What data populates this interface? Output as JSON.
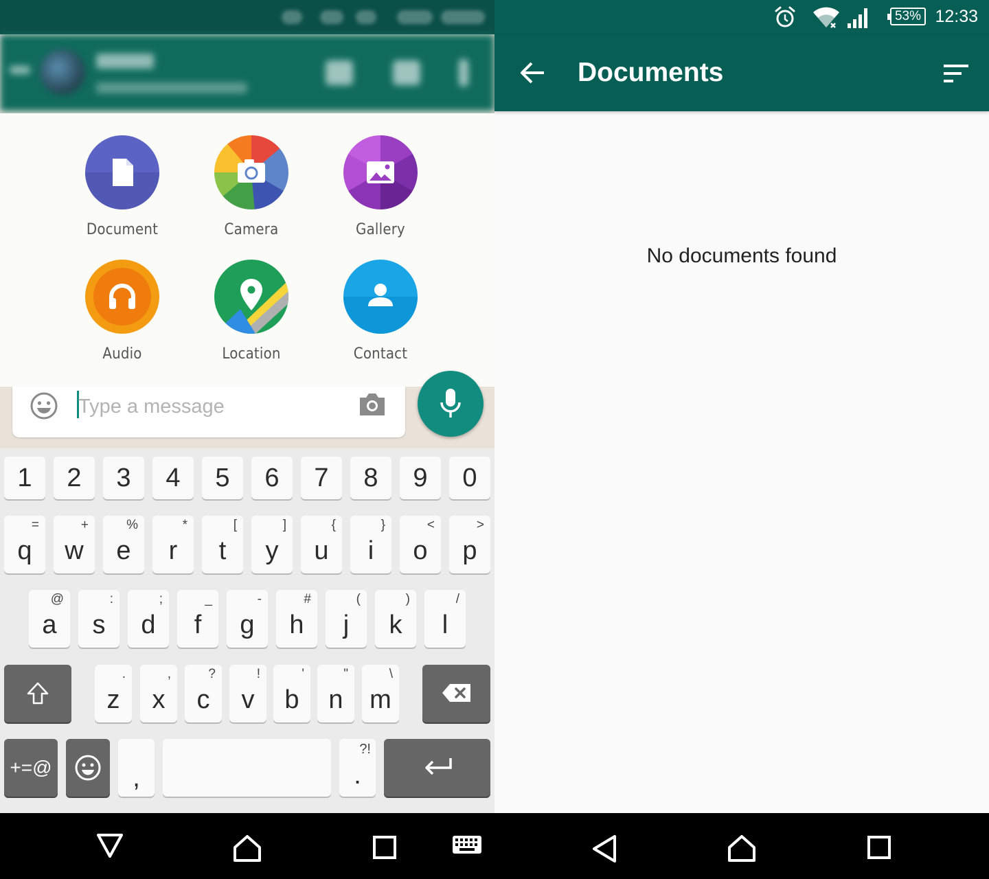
{
  "left": {
    "attach_items": [
      {
        "label": "Document",
        "icon": "document-icon"
      },
      {
        "label": "Camera",
        "icon": "camera-icon"
      },
      {
        "label": "Gallery",
        "icon": "gallery-icon"
      },
      {
        "label": "Audio",
        "icon": "headphones-icon"
      },
      {
        "label": "Location",
        "icon": "location-pin-icon"
      },
      {
        "label": "Contact",
        "icon": "person-icon"
      }
    ],
    "message_placeholder": "Type a message",
    "keyboard": {
      "numbers": [
        "1",
        "2",
        "3",
        "4",
        "5",
        "6",
        "7",
        "8",
        "9",
        "0"
      ],
      "row1": [
        [
          "q",
          "="
        ],
        [
          "w",
          "+"
        ],
        [
          "e",
          "%"
        ],
        [
          "r",
          "*"
        ],
        [
          "t",
          "["
        ],
        [
          "y",
          "]"
        ],
        [
          "u",
          "{"
        ],
        [
          "i",
          "}"
        ],
        [
          "o",
          "<"
        ],
        [
          "p",
          ">"
        ]
      ],
      "row2": [
        [
          "a",
          "@"
        ],
        [
          "s",
          ":"
        ],
        [
          "d",
          ";"
        ],
        [
          "f",
          "_"
        ],
        [
          "g",
          "-"
        ],
        [
          "h",
          "#"
        ],
        [
          "j",
          "("
        ],
        [
          "k",
          ")"
        ],
        [
          "l",
          "/"
        ]
      ],
      "row3": [
        [
          "z",
          "."
        ],
        [
          "x",
          ","
        ],
        [
          "c",
          "?"
        ],
        [
          "v",
          "!"
        ],
        [
          "b",
          "'"
        ],
        [
          "n",
          "\""
        ],
        [
          "m",
          "\\"
        ]
      ],
      "symbols_label": "+=@",
      "comma": ",",
      "period": ".",
      "period_sub": "?!"
    }
  },
  "right": {
    "status": {
      "battery": "53%",
      "time": "12:33"
    },
    "title": "Documents",
    "empty_message": "No documents found"
  },
  "colors": {
    "primary": "#075e54",
    "accent": "#128c7e"
  }
}
